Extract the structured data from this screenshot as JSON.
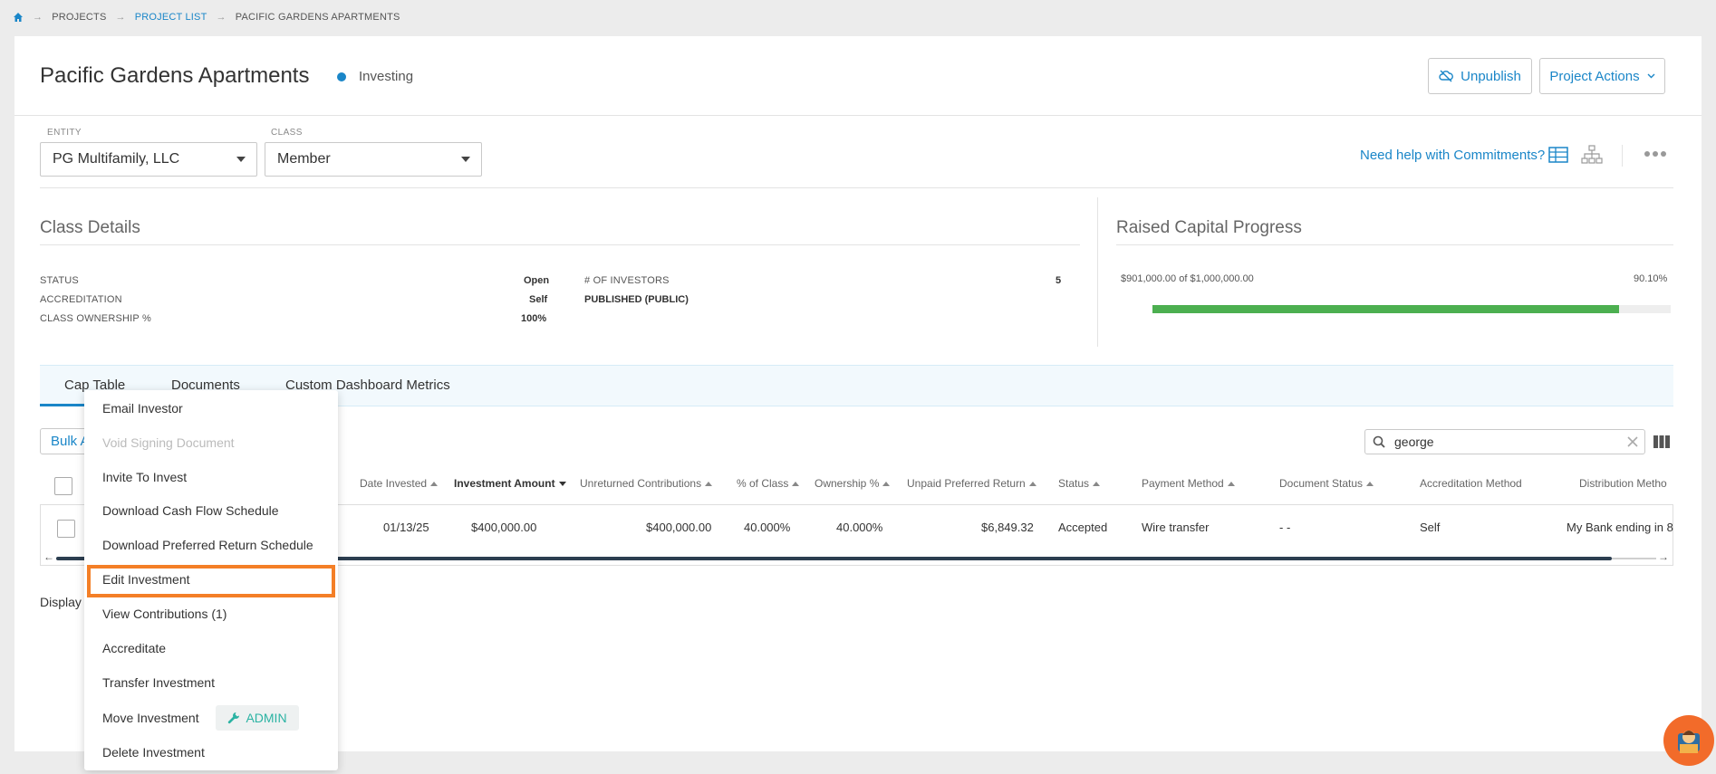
{
  "breadcrumb": {
    "items": [
      "PROJECTS",
      "PROJECT LIST",
      "PACIFIC GARDENS APARTMENTS"
    ]
  },
  "header": {
    "title": "Pacific Gardens Apartments",
    "status": "Investing",
    "unpublish_label": "Unpublish",
    "project_actions_label": "Project Actions"
  },
  "filters": {
    "entity_label": "ENTITY",
    "entity_value": "PG Multifamily, LLC",
    "class_label": "CLASS",
    "class_value": "Member",
    "help_link": "Need help with Commitments?"
  },
  "class_details": {
    "title": "Class Details",
    "status_label": "STATUS",
    "status_value": "Open",
    "accreditation_label": "ACCREDITATION",
    "accreditation_value": "Self",
    "ownership_label": "CLASS OWNERSHIP %",
    "ownership_value": "100%",
    "investors_label": "# OF INVESTORS",
    "investors_value": "5",
    "published": "PUBLISHED (PUBLIC)"
  },
  "raised_capital": {
    "title": "Raised Capital Progress",
    "amount_text": "$901,000.00 of $1,000,000.00",
    "percent_text": "90.10%",
    "fraction": 0.901
  },
  "tabs": [
    {
      "label": "Cap Table"
    },
    {
      "label": "Documents"
    },
    {
      "label": "Custom Dashboard Metrics"
    }
  ],
  "toolbar": {
    "bulk_label": "Bulk A",
    "search_value": "george",
    "display_text": "Display"
  },
  "table": {
    "columns": [
      "Date Invested",
      "Investment Amount",
      "Unreturned Contributions",
      "% of Class",
      "Ownership %",
      "Unpaid Preferred Return",
      "Status",
      "Payment Method",
      "Document Status",
      "Accreditation Method",
      "Distribution Metho"
    ],
    "row": {
      "date_invested": "01/13/25",
      "investment_amount": "$400,000.00",
      "unreturned": "$400,000.00",
      "pct_class": "40.000%",
      "ownership": "40.000%",
      "unpaid_pref": "$6,849.32",
      "status": "Accepted",
      "payment": "Wire transfer",
      "doc_status": "- -",
      "accreditation": "Self",
      "distribution": "My Bank ending in 8"
    }
  },
  "menu": {
    "items": [
      "Email Investor",
      "Void Signing Document",
      "Invite To Invest",
      "Download Cash Flow Schedule",
      "Download Preferred Return Schedule",
      "Edit Investment",
      "View Contributions (1)",
      "Accreditate",
      "Transfer Investment",
      "Move Investment",
      "Delete Investment"
    ],
    "admin_label": "ADMIN"
  },
  "colors": {
    "accent": "#1a86c8",
    "progress": "#4caf50",
    "highlight": "#f47f27",
    "admin": "#2bb3a3"
  }
}
